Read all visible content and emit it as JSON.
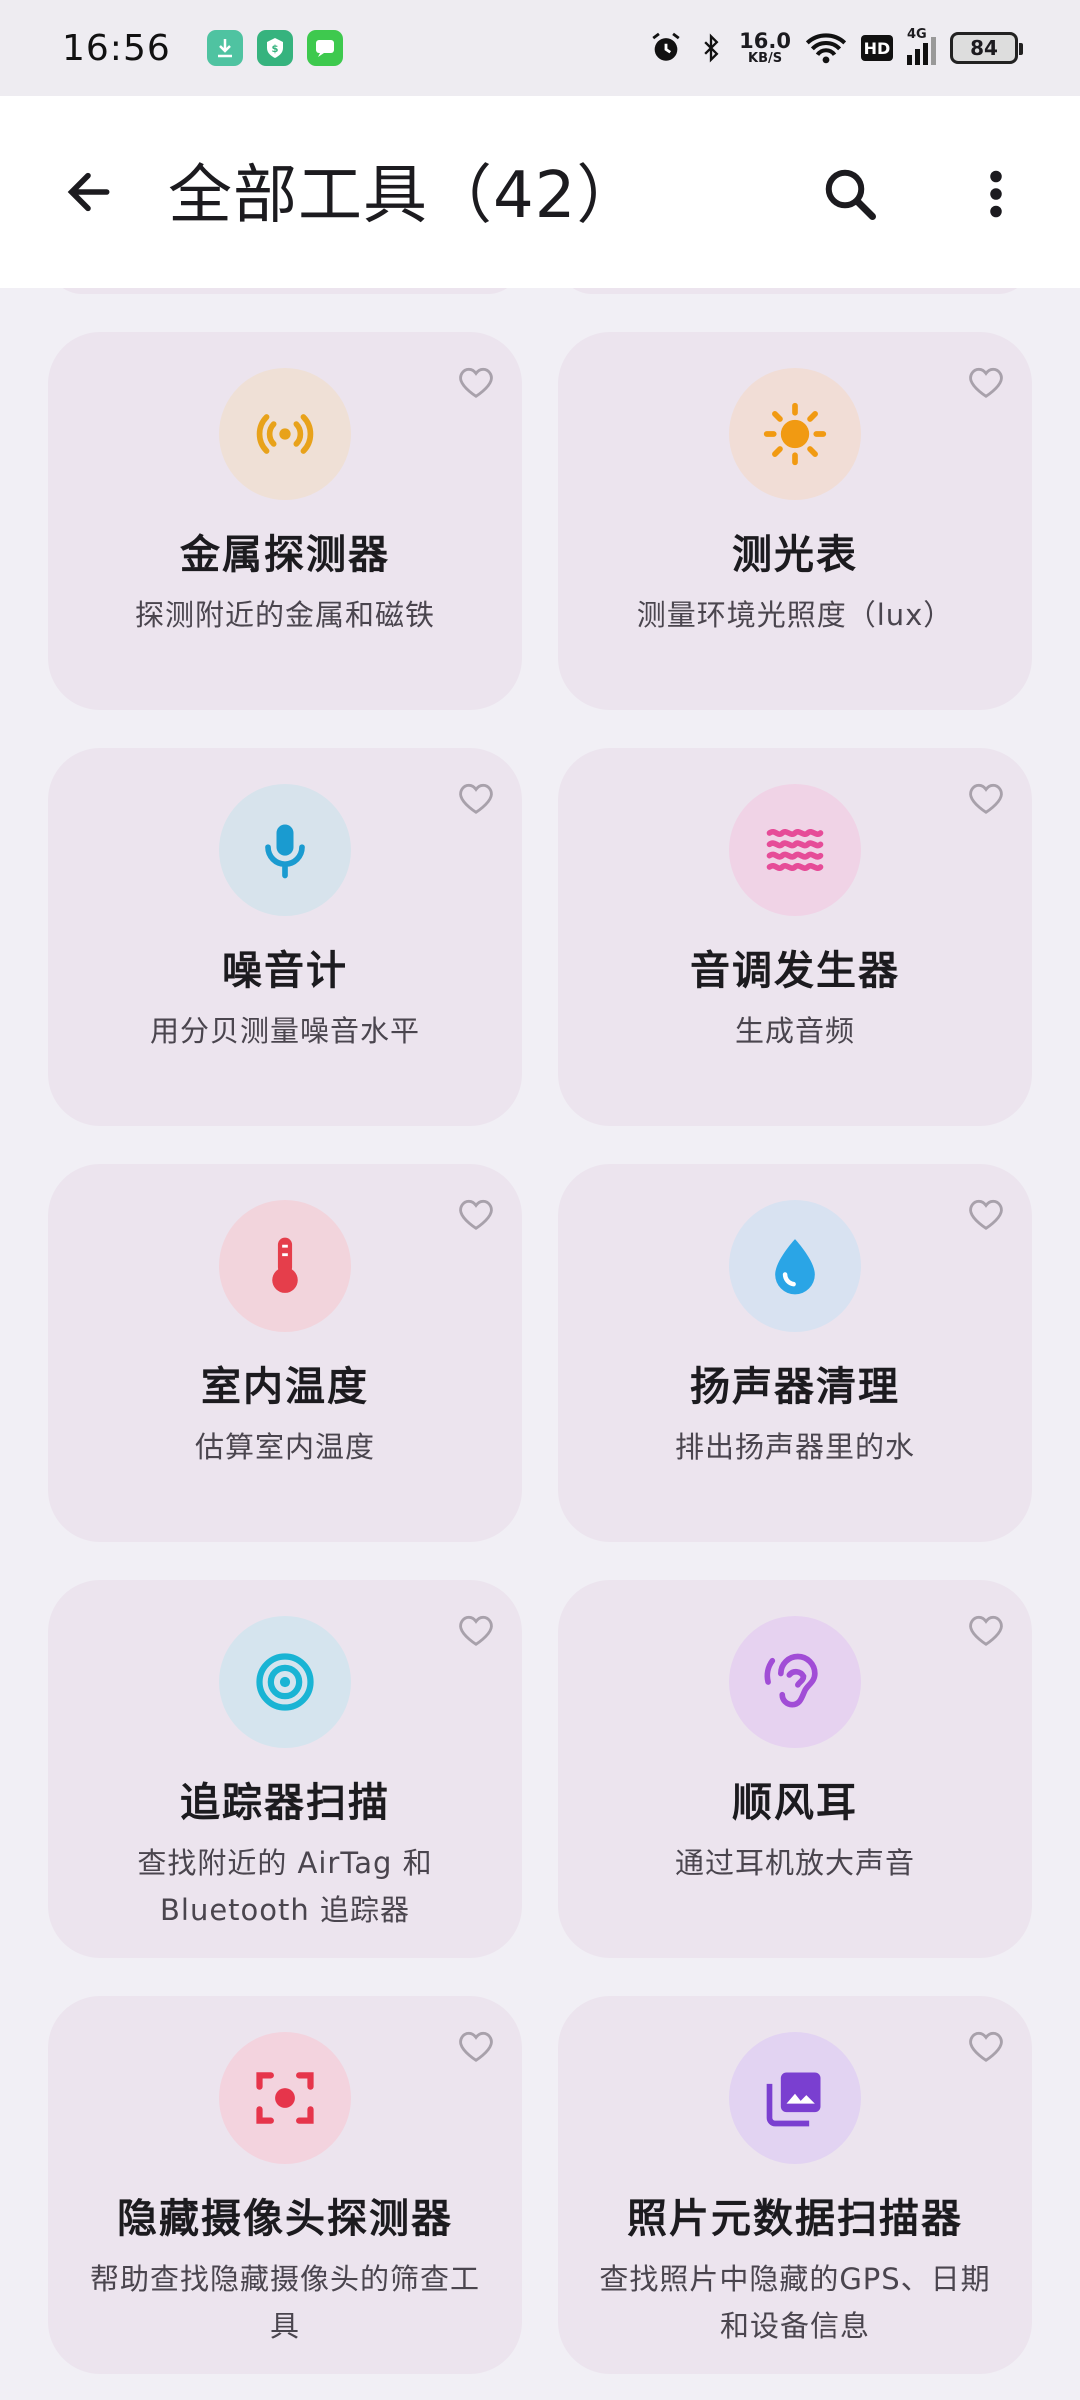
{
  "status_bar": {
    "time": "16:56",
    "net_speed_value": "16.0",
    "net_speed_unit": "KB/S",
    "hd_label": "HD",
    "signal_label": "4G",
    "battery": "84"
  },
  "header": {
    "title": "全部工具（42）"
  },
  "tools": [
    {
      "title": "金属探测器",
      "desc": "探测附近的金属和磁铁",
      "icon": "metal-detector-icon",
      "color": "#e8a21a",
      "bg": "#efe0d6"
    },
    {
      "title": "测光表",
      "desc": "测量环境光照度（lux）",
      "icon": "sun-icon",
      "color": "#f19a12",
      "bg": "#f1ddd6"
    },
    {
      "title": "噪音计",
      "desc": "用分贝测量噪音水平",
      "icon": "microphone-icon",
      "color": "#1a9bd0",
      "bg": "#d7e3ec"
    },
    {
      "title": "音调发生器",
      "desc": "生成音频",
      "icon": "waves-icon",
      "color": "#e64c98",
      "bg": "#f0d3e6"
    },
    {
      "title": "室内温度",
      "desc": "估算室内温度",
      "icon": "thermometer-icon",
      "color": "#e53e4b",
      "bg": "#f2d4dc"
    },
    {
      "title": "扬声器清理",
      "desc": "排出扬声器里的水",
      "icon": "water-drop-icon",
      "color": "#2aa5e6",
      "bg": "#d8e2f1"
    },
    {
      "title": "追踪器扫描",
      "desc": "查找附近的 AirTag 和 Bluetooth 追踪器",
      "icon": "tracker-icon",
      "color": "#19b4d4",
      "bg": "#d5e4ee"
    },
    {
      "title": "顺风耳",
      "desc": "通过耳机放大声音",
      "icon": "ear-icon",
      "color": "#a14dd6",
      "bg": "#e6d2f0"
    },
    {
      "title": "隐藏摄像头探测器",
      "desc": "帮助查找隐藏摄像头的筛查工具",
      "icon": "camera-scan-icon",
      "color": "#e6354b",
      "bg": "#f3d3de"
    },
    {
      "title": "照片元数据扫描器",
      "desc": "查找照片中隐藏的GPS、日期和设备信息",
      "icon": "photo-library-icon",
      "color": "#7a3fd0",
      "bg": "#e2d3f2"
    }
  ]
}
